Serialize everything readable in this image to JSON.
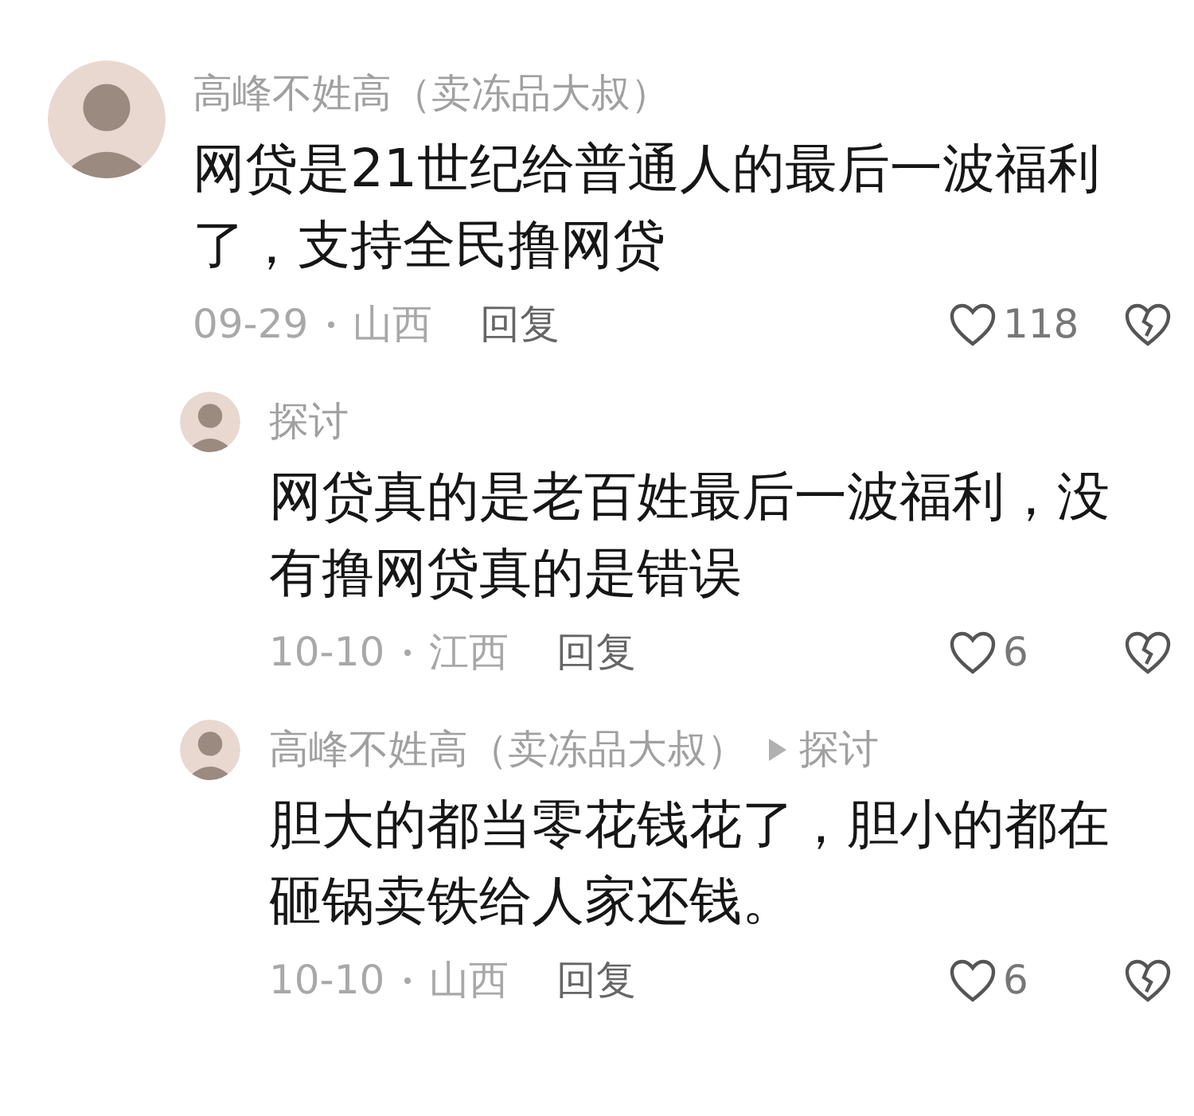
{
  "comments": [
    {
      "author": "高峰不姓高（卖冻品大叔）",
      "text": "网贷是21世纪给普通人的最后一波福利了，支持全民撸网贷",
      "date": "09-29",
      "region": "山西",
      "reply_label": "回复",
      "likes": "118",
      "children": [
        {
          "author": "探讨",
          "text": "网贷真的是老百姓最后一波福利，没有撸网贷真的是错误",
          "date": "10-10",
          "region": "江西",
          "reply_label": "回复",
          "likes": "6"
        },
        {
          "author": "高峰不姓高（卖冻品大叔）",
          "reply_to": "探讨",
          "text": "胆大的都当零花钱花了，胆小的都在砸锅卖铁给人家还钱。",
          "date": "10-10",
          "region": "山西",
          "reply_label": "回复",
          "likes": "6"
        }
      ]
    }
  ]
}
